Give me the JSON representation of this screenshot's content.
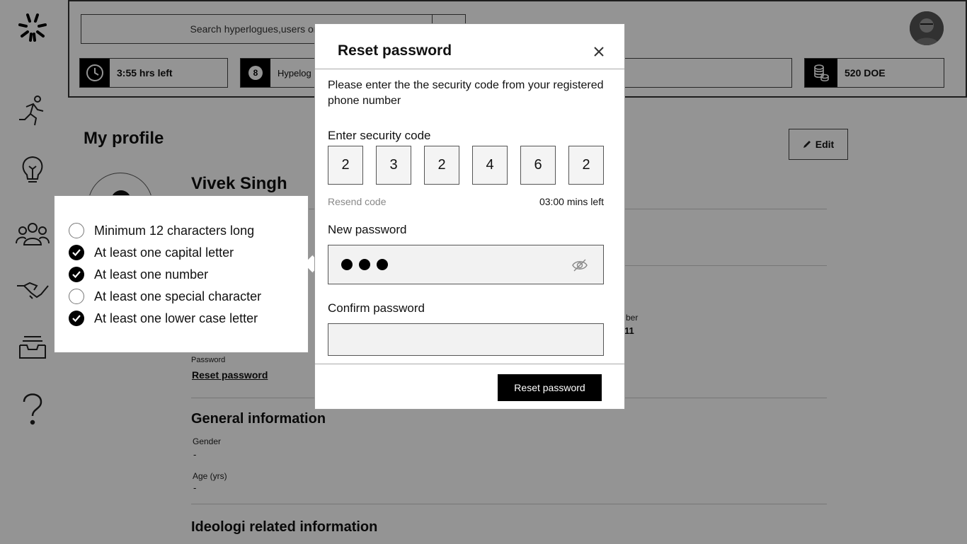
{
  "topbar": {
    "search_placeholder": "Search hyperlogues,users or archives",
    "time_left": "3:55 hrs left",
    "hyperlogues_badge": "8",
    "hyperlogues_label": "Hypelog",
    "doe_balance": "520 DOE"
  },
  "sidebar": {
    "icons": [
      "logo-icon",
      "runner-icon",
      "lightbulb-icon",
      "people-icon",
      "handshake-icon",
      "inbox-icon",
      "help-icon"
    ]
  },
  "profile": {
    "page_title": "My profile",
    "edit_label": "Edit",
    "name": "Vivek Singh",
    "phone_label_fragment": "ber",
    "phone_value_fragment": "11",
    "password_label": "Password",
    "reset_link": "Reset password",
    "general_title": "General information",
    "gender_label": "Gender",
    "gender_value": "-",
    "age_label": "Age (yrs)",
    "age_value": "-",
    "ideologi_title": "Ideologi related information"
  },
  "modal": {
    "title": "Reset password",
    "intro": "Please enter the the security code from your registered phone number",
    "code_label": "Enter security code",
    "code_digits": [
      "2",
      "3",
      "2",
      "4",
      "6",
      "2"
    ],
    "resend_label": "Resend code",
    "timer": "03:00 mins left",
    "new_password_label": "New password",
    "confirm_password_label": "Confirm password",
    "confirm_password_value": "",
    "submit_label": "Reset password"
  },
  "requirements": [
    {
      "label": "Minimum 12 characters long",
      "met": false
    },
    {
      "label": "At least one capital letter",
      "met": true
    },
    {
      "label": "At least one number",
      "met": true
    },
    {
      "label": "At least one special character",
      "met": false
    },
    {
      "label": "At least one lower case letter",
      "met": true
    }
  ]
}
